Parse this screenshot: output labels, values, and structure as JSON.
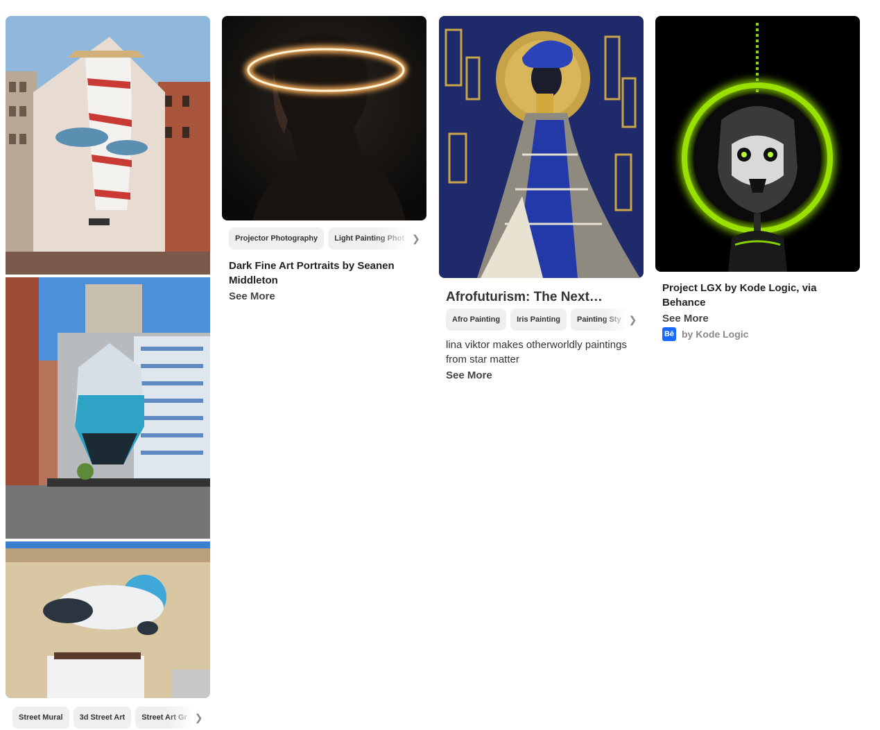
{
  "pins": {
    "street": {
      "chips": [
        "Street Mural",
        "3d Street Art",
        "Street Art Gr"
      ]
    },
    "halo": {
      "chips": [
        "Projector Photography",
        "Light Painting Phot"
      ],
      "title": "Dark Fine Art Portraits by Seanen Middleton",
      "see_more": "See More"
    },
    "afro": {
      "title": "Afrofuturism: The Next…",
      "chips": [
        "Afro Painting",
        "Iris Painting",
        "Painting Sty"
      ],
      "description": "lina viktor makes otherworldly paintings from star matter",
      "see_more": "See More"
    },
    "lgx": {
      "title": "Project LGX by Kode Logic, via Behance",
      "see_more": "See More",
      "source_badge": "Bē",
      "byline": "by Kode Logic"
    }
  },
  "icons": {
    "chip_scroll": "chevron-right-icon",
    "source": "behance-icon"
  },
  "colors": {
    "chip_bg": "#efefef",
    "behance_blue": "#1769ff",
    "lgx_green": "#8ad100"
  }
}
